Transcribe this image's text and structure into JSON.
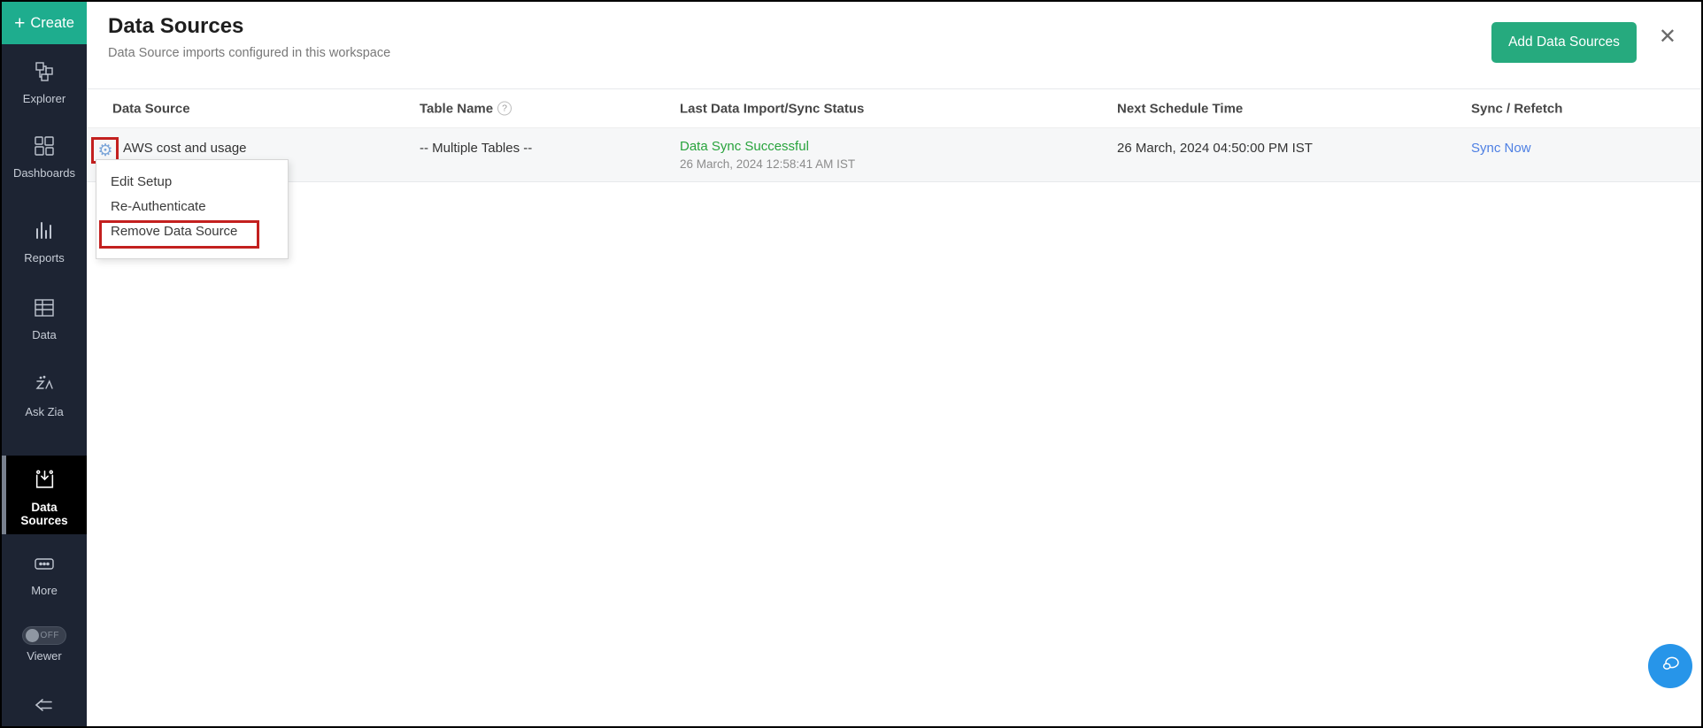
{
  "sidebar": {
    "create_label": "Create",
    "items": [
      {
        "label": "Explorer"
      },
      {
        "label": "Dashboards"
      },
      {
        "label": "Reports"
      },
      {
        "label": "Data"
      },
      {
        "label": "Ask Zia"
      },
      {
        "label": "Data Sources",
        "active": true
      },
      {
        "label": "More"
      }
    ],
    "viewer": {
      "label": "Viewer",
      "toggle_state": "OFF"
    }
  },
  "header": {
    "title": "Data Sources",
    "subtitle": "Data Source imports configured in this workspace",
    "add_button_label": "Add Data Sources"
  },
  "icons": {
    "close": "✕",
    "gear": "⚙",
    "help": "?",
    "plus": "+"
  },
  "table": {
    "columns": [
      "Data Source",
      "Table Name",
      "Last Data Import/Sync Status",
      "Next Schedule Time",
      "Sync / Refetch"
    ],
    "rows": [
      {
        "data_source": "AWS cost and usage",
        "table_name": "-- Multiple Tables --",
        "sync_status": "Data Sync Successful",
        "last_sync_time": "26 March, 2024 12:58:41 AM IST",
        "next_schedule_time": "26 March, 2024 04:50:00 PM IST",
        "action": "Sync Now"
      }
    ]
  },
  "context_menu": {
    "items": [
      "Edit Setup",
      "Re-Authenticate",
      "Remove Data Source"
    ],
    "highlighted_item": "Remove Data Source"
  },
  "colors": {
    "sidebar_bg": "#1d2433",
    "create_teal": "#1ead8e",
    "add_button_green": "#26aa7e",
    "status_green": "#28a33c",
    "link_blue": "#4d7fe3",
    "annotation_red": "#c3201f",
    "chat_blue": "#2795e9",
    "active_item_bg": "#000000"
  }
}
